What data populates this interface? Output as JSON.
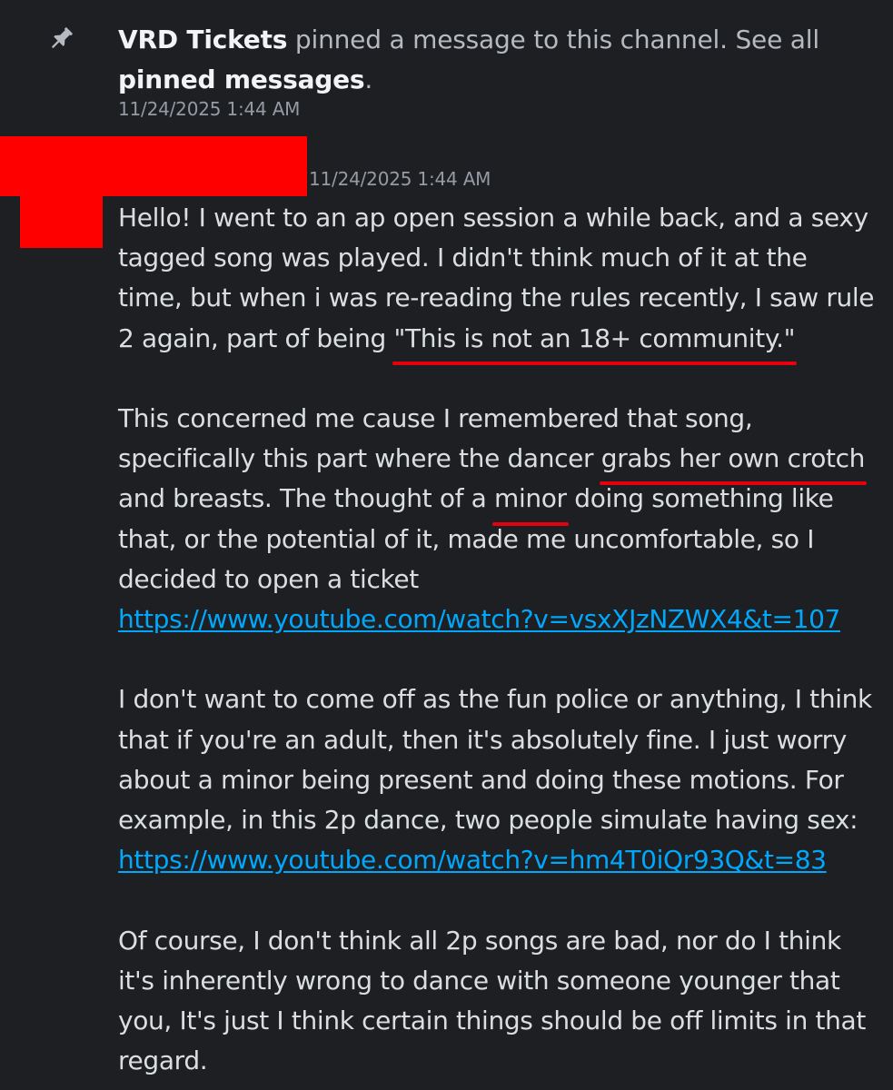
{
  "pin_event": {
    "icon": "pin-icon",
    "author": "VRD Tickets",
    "action_text": " pinned a message to this channel. See all ",
    "link_text": "pinned messages",
    "trailing": ".",
    "timestamp": "11/24/2025 1:44 AM"
  },
  "message": {
    "timestamp": "11/24/2025 1:44 AM",
    "redaction_color": "#ff0000",
    "paragraph1": {
      "text_before": "Hello! I went to an ap open session a while back, and a sexy tagged song was played. I didn't think much of it at the time, but when i was re-reading the rules recently, I saw rule 2 again, part of being ",
      "highlight": "\"This is not an 18+ community.\""
    },
    "paragraph2": {
      "t1": "This concerned me cause I remembered that song, specifically this part where the dancer ",
      "h1": "grabs her own crotch",
      "t2": " and breasts. The thought of a ",
      "h2": "minor",
      "t3": " doing something like that, or the potential of it, made me uncomfortable, so I decided to open a ticket",
      "link": "https://www.youtube.com/watch?v=vsxXJzNZWX4&t=107"
    },
    "paragraph3": {
      "text": "I don't want to come off as the fun police or anything, I think that if you're an adult, then it's absolutely fine. I just worry about a minor being present and doing these motions.  For example, in this 2p dance, two people simulate having sex:",
      "link": "https://www.youtube.com/watch?v=hm4T0iQr93Q&t=83"
    },
    "paragraph4": {
      "text": "Of course, I don't think all 2p songs are bad, nor do I think it's inherently wrong to dance with someone younger that you, It's just I think certain things should be off limits in that regard."
    }
  },
  "colors": {
    "background": "#1e1f22",
    "text": "#dbdee1",
    "muted": "#949ba4",
    "link": "#00a8fc",
    "annotation_underline": "#e5000f"
  }
}
